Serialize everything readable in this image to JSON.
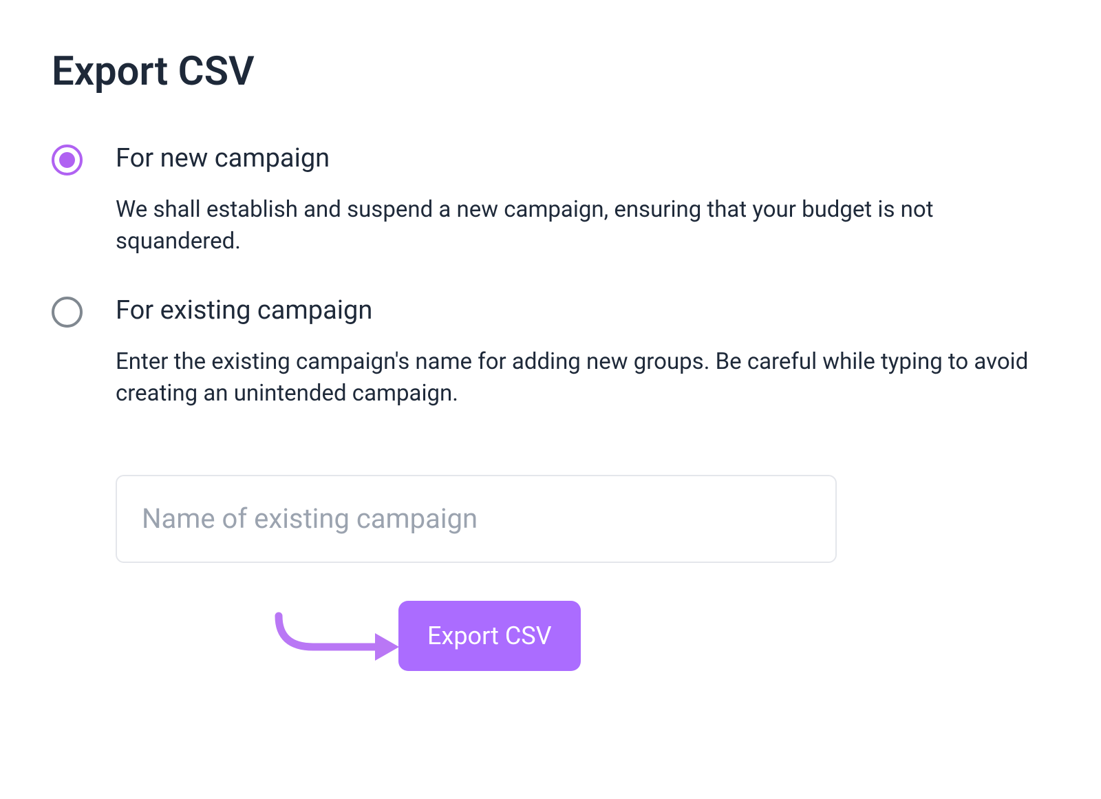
{
  "title": "Export CSV",
  "options": [
    {
      "label": "For new campaign",
      "description": "We shall establish and suspend a new campaign, ensuring that your budget is not squandered.",
      "selected": true
    },
    {
      "label": "For existing campaign",
      "description": "Enter the existing campaign's name for adding new groups. Be careful while typing to avoid creating an unintended campaign.",
      "selected": false
    }
  ],
  "campaign_input": {
    "placeholder": "Name of existing campaign",
    "value": ""
  },
  "export_button_label": "Export CSV",
  "colors": {
    "accent": "#ab6cff",
    "radio_selected": "#b062f2",
    "text": "#1e2939",
    "placeholder": "#9ba3af",
    "border": "#e4e6eb"
  }
}
